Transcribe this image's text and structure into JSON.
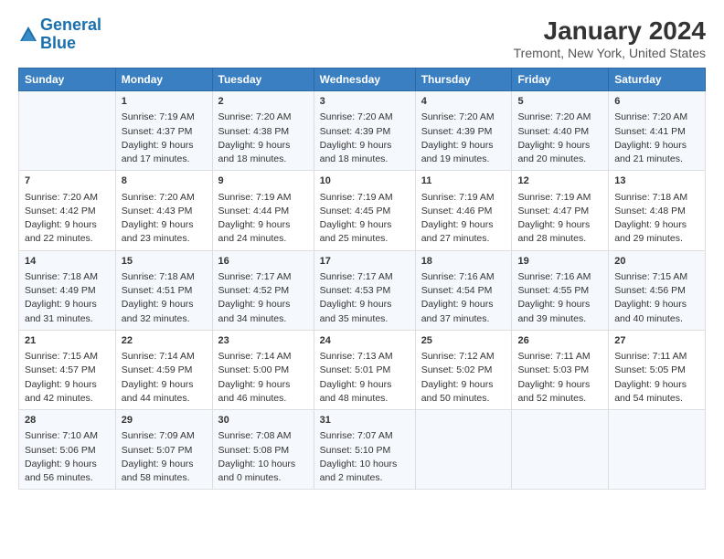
{
  "header": {
    "logo_line1": "General",
    "logo_line2": "Blue",
    "title": "January 2024",
    "subtitle": "Tremont, New York, United States"
  },
  "days_of_week": [
    "Sunday",
    "Monday",
    "Tuesday",
    "Wednesday",
    "Thursday",
    "Friday",
    "Saturday"
  ],
  "weeks": [
    [
      {
        "day": "",
        "content": ""
      },
      {
        "day": "1",
        "content": "Sunrise: 7:19 AM\nSunset: 4:37 PM\nDaylight: 9 hours\nand 17 minutes."
      },
      {
        "day": "2",
        "content": "Sunrise: 7:20 AM\nSunset: 4:38 PM\nDaylight: 9 hours\nand 18 minutes."
      },
      {
        "day": "3",
        "content": "Sunrise: 7:20 AM\nSunset: 4:39 PM\nDaylight: 9 hours\nand 18 minutes."
      },
      {
        "day": "4",
        "content": "Sunrise: 7:20 AM\nSunset: 4:39 PM\nDaylight: 9 hours\nand 19 minutes."
      },
      {
        "day": "5",
        "content": "Sunrise: 7:20 AM\nSunset: 4:40 PM\nDaylight: 9 hours\nand 20 minutes."
      },
      {
        "day": "6",
        "content": "Sunrise: 7:20 AM\nSunset: 4:41 PM\nDaylight: 9 hours\nand 21 minutes."
      }
    ],
    [
      {
        "day": "7",
        "content": "Sunrise: 7:20 AM\nSunset: 4:42 PM\nDaylight: 9 hours\nand 22 minutes."
      },
      {
        "day": "8",
        "content": "Sunrise: 7:20 AM\nSunset: 4:43 PM\nDaylight: 9 hours\nand 23 minutes."
      },
      {
        "day": "9",
        "content": "Sunrise: 7:19 AM\nSunset: 4:44 PM\nDaylight: 9 hours\nand 24 minutes."
      },
      {
        "day": "10",
        "content": "Sunrise: 7:19 AM\nSunset: 4:45 PM\nDaylight: 9 hours\nand 25 minutes."
      },
      {
        "day": "11",
        "content": "Sunrise: 7:19 AM\nSunset: 4:46 PM\nDaylight: 9 hours\nand 27 minutes."
      },
      {
        "day": "12",
        "content": "Sunrise: 7:19 AM\nSunset: 4:47 PM\nDaylight: 9 hours\nand 28 minutes."
      },
      {
        "day": "13",
        "content": "Sunrise: 7:18 AM\nSunset: 4:48 PM\nDaylight: 9 hours\nand 29 minutes."
      }
    ],
    [
      {
        "day": "14",
        "content": "Sunrise: 7:18 AM\nSunset: 4:49 PM\nDaylight: 9 hours\nand 31 minutes."
      },
      {
        "day": "15",
        "content": "Sunrise: 7:18 AM\nSunset: 4:51 PM\nDaylight: 9 hours\nand 32 minutes."
      },
      {
        "day": "16",
        "content": "Sunrise: 7:17 AM\nSunset: 4:52 PM\nDaylight: 9 hours\nand 34 minutes."
      },
      {
        "day": "17",
        "content": "Sunrise: 7:17 AM\nSunset: 4:53 PM\nDaylight: 9 hours\nand 35 minutes."
      },
      {
        "day": "18",
        "content": "Sunrise: 7:16 AM\nSunset: 4:54 PM\nDaylight: 9 hours\nand 37 minutes."
      },
      {
        "day": "19",
        "content": "Sunrise: 7:16 AM\nSunset: 4:55 PM\nDaylight: 9 hours\nand 39 minutes."
      },
      {
        "day": "20",
        "content": "Sunrise: 7:15 AM\nSunset: 4:56 PM\nDaylight: 9 hours\nand 40 minutes."
      }
    ],
    [
      {
        "day": "21",
        "content": "Sunrise: 7:15 AM\nSunset: 4:57 PM\nDaylight: 9 hours\nand 42 minutes."
      },
      {
        "day": "22",
        "content": "Sunrise: 7:14 AM\nSunset: 4:59 PM\nDaylight: 9 hours\nand 44 minutes."
      },
      {
        "day": "23",
        "content": "Sunrise: 7:14 AM\nSunset: 5:00 PM\nDaylight: 9 hours\nand 46 minutes."
      },
      {
        "day": "24",
        "content": "Sunrise: 7:13 AM\nSunset: 5:01 PM\nDaylight: 9 hours\nand 48 minutes."
      },
      {
        "day": "25",
        "content": "Sunrise: 7:12 AM\nSunset: 5:02 PM\nDaylight: 9 hours\nand 50 minutes."
      },
      {
        "day": "26",
        "content": "Sunrise: 7:11 AM\nSunset: 5:03 PM\nDaylight: 9 hours\nand 52 minutes."
      },
      {
        "day": "27",
        "content": "Sunrise: 7:11 AM\nSunset: 5:05 PM\nDaylight: 9 hours\nand 54 minutes."
      }
    ],
    [
      {
        "day": "28",
        "content": "Sunrise: 7:10 AM\nSunset: 5:06 PM\nDaylight: 9 hours\nand 56 minutes."
      },
      {
        "day": "29",
        "content": "Sunrise: 7:09 AM\nSunset: 5:07 PM\nDaylight: 9 hours\nand 58 minutes."
      },
      {
        "day": "30",
        "content": "Sunrise: 7:08 AM\nSunset: 5:08 PM\nDaylight: 10 hours\nand 0 minutes."
      },
      {
        "day": "31",
        "content": "Sunrise: 7:07 AM\nSunset: 5:10 PM\nDaylight: 10 hours\nand 2 minutes."
      },
      {
        "day": "",
        "content": ""
      },
      {
        "day": "",
        "content": ""
      },
      {
        "day": "",
        "content": ""
      }
    ]
  ]
}
